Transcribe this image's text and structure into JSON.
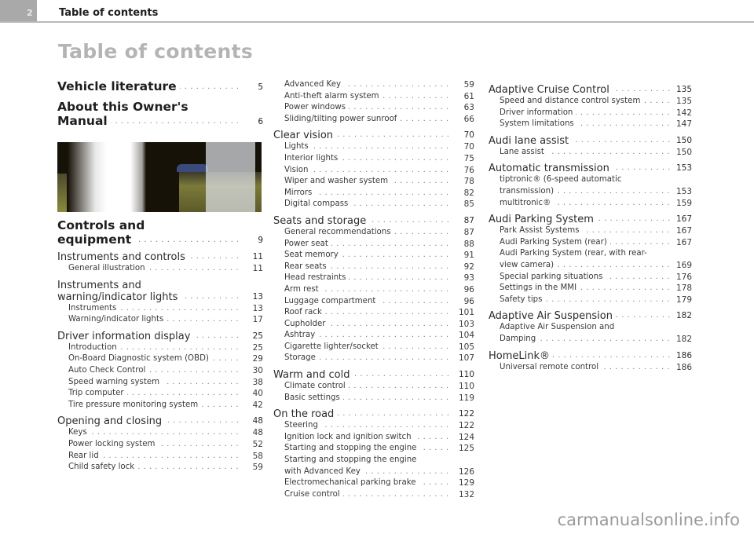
{
  "header": {
    "page_number": "2",
    "running_title": "Table of contents"
  },
  "title": "Table of contents",
  "columns": [
    {
      "entries": [
        {
          "level": 0,
          "label": "Vehicle literature",
          "page": "5"
        },
        {
          "level": 0,
          "label_line1": "About this Owner's",
          "label_line2": "Manual",
          "page": "6"
        },
        {
          "level": 0,
          "label_line1": "Controls and",
          "label_line2": "equipment",
          "page": "9"
        },
        {
          "level": 1,
          "label": "Instruments and controls",
          "page": "11"
        },
        {
          "level": 2,
          "label": "General illustration",
          "page": "11"
        },
        {
          "level": 1,
          "label_line1": "Instruments and",
          "label_line2": "warning/indicator lights",
          "page": "13"
        },
        {
          "level": 2,
          "label": "Instruments",
          "page": "13"
        },
        {
          "level": 2,
          "label": "Warning/indicator lights",
          "page": "17"
        },
        {
          "level": 1,
          "label": "Driver information display",
          "page": "25"
        },
        {
          "level": 2,
          "label": "Introduction",
          "page": "25"
        },
        {
          "level": 2,
          "label": "On-Board Diagnostic system (OBD)",
          "page": "29"
        },
        {
          "level": 2,
          "label": "Auto Check Control",
          "page": "30"
        },
        {
          "level": 2,
          "label": "Speed warning system",
          "page": "38"
        },
        {
          "level": 2,
          "label": "Trip computer",
          "page": "40"
        },
        {
          "level": 2,
          "label": "Tire pressure monitoring system",
          "page": "42"
        },
        {
          "level": 1,
          "label": "Opening and closing",
          "page": "48"
        },
        {
          "level": 2,
          "label": "Keys",
          "page": "48"
        },
        {
          "level": 2,
          "label": "Power locking system",
          "page": "52"
        },
        {
          "level": 2,
          "label": "Rear lid",
          "page": "58"
        },
        {
          "level": 2,
          "label": "Child safety lock",
          "page": "59"
        }
      ]
    },
    {
      "entries": [
        {
          "level": 2,
          "label": "Advanced Key",
          "page": "59"
        },
        {
          "level": 2,
          "label": "Anti-theft alarm system",
          "page": "61"
        },
        {
          "level": 2,
          "label": "Power windows",
          "page": "63"
        },
        {
          "level": 2,
          "label": "Sliding/tilting power sunroof",
          "page": "66"
        },
        {
          "level": 1,
          "label": "Clear vision",
          "page": "70"
        },
        {
          "level": 2,
          "label": "Lights",
          "page": "70"
        },
        {
          "level": 2,
          "label": "Interior lights",
          "page": "75"
        },
        {
          "level": 2,
          "label": "Vision",
          "page": "76"
        },
        {
          "level": 2,
          "label": "Wiper and washer system",
          "page": "78"
        },
        {
          "level": 2,
          "label": "Mirrors",
          "page": "82"
        },
        {
          "level": 2,
          "label": "Digital compass",
          "page": "85"
        },
        {
          "level": 1,
          "label": "Seats and storage",
          "page": "87"
        },
        {
          "level": 2,
          "label": "General recommendations",
          "page": "87"
        },
        {
          "level": 2,
          "label": "Power seat",
          "page": "88"
        },
        {
          "level": 2,
          "label": "Seat memory",
          "page": "91"
        },
        {
          "level": 2,
          "label": "Rear seats",
          "page": "92"
        },
        {
          "level": 2,
          "label": "Head restraints",
          "page": "93"
        },
        {
          "level": 2,
          "label": "Arm rest",
          "page": "96"
        },
        {
          "level": 2,
          "label": "Luggage compartment",
          "page": "96"
        },
        {
          "level": 2,
          "label": "Roof rack",
          "page": "101"
        },
        {
          "level": 2,
          "label": "Cupholder",
          "page": "103"
        },
        {
          "level": 2,
          "label": "Ashtray",
          "page": "104"
        },
        {
          "level": 2,
          "label": "Cigarette lighter/socket",
          "page": "105"
        },
        {
          "level": 2,
          "label": "Storage",
          "page": "107"
        },
        {
          "level": 1,
          "label": "Warm and cold",
          "page": "110"
        },
        {
          "level": 2,
          "label": "Climate control",
          "page": "110"
        },
        {
          "level": 2,
          "label": "Basic settings",
          "page": "119"
        },
        {
          "level": 1,
          "label": "On the road",
          "page": "122"
        },
        {
          "level": 2,
          "label": "Steering",
          "page": "122"
        },
        {
          "level": 2,
          "label": "Ignition lock and ignition switch",
          "page": "124"
        },
        {
          "level": 2,
          "label": "Starting and stopping the engine",
          "page": "125"
        },
        {
          "level": 2,
          "label_line1": "Starting and stopping the engine",
          "label_line2": "with Advanced Key",
          "page": "126"
        },
        {
          "level": 2,
          "label": "Electromechanical parking brake",
          "page": "129"
        },
        {
          "level": 2,
          "label": "Cruise control",
          "page": "132"
        }
      ]
    },
    {
      "entries": [
        {
          "level": 1,
          "label": "Adaptive Cruise Control",
          "page": "135"
        },
        {
          "level": 2,
          "label": "Speed and distance control system",
          "page": "135"
        },
        {
          "level": 2,
          "label": "Driver information",
          "page": "142"
        },
        {
          "level": 2,
          "label": "System limitations",
          "page": "147"
        },
        {
          "level": 1,
          "label": "Audi lane assist",
          "page": "150"
        },
        {
          "level": 2,
          "label": "Lane assist",
          "page": "150"
        },
        {
          "level": 1,
          "label": "Automatic transmission",
          "page": "153"
        },
        {
          "level": 2,
          "label_line1": "tiptronic® (6-speed automatic",
          "label_line2": "transmission)",
          "page": "153"
        },
        {
          "level": 2,
          "label": "multitronic®",
          "page": "159"
        },
        {
          "level": 1,
          "label": "Audi Parking System",
          "page": "167"
        },
        {
          "level": 2,
          "label": "Park Assist Systems",
          "page": "167"
        },
        {
          "level": 2,
          "label": "Audi Parking System (rear)",
          "page": "167"
        },
        {
          "level": 2,
          "label_line1": "Audi Parking System (rear, with rear-",
          "label_line2": "view camera)",
          "page": "169"
        },
        {
          "level": 2,
          "label": "Special parking situations",
          "page": "176"
        },
        {
          "level": 2,
          "label": "Settings in the MMI",
          "page": "178"
        },
        {
          "level": 2,
          "label": "Safety tips",
          "page": "179"
        },
        {
          "level": 1,
          "label": "Adaptive Air Suspension",
          "page": "182"
        },
        {
          "level": 2,
          "label_line1": "Adaptive Air Suspension and",
          "label_line2": "Damping",
          "page": "182"
        },
        {
          "level": 1,
          "label": "HomeLink®",
          "page": "186"
        },
        {
          "level": 2,
          "label": "Universal remote control",
          "page": "186"
        }
      ]
    }
  ],
  "image": {
    "description": "cockpit-dashboard-photo"
  },
  "watermark": "carmanualsonline.info"
}
